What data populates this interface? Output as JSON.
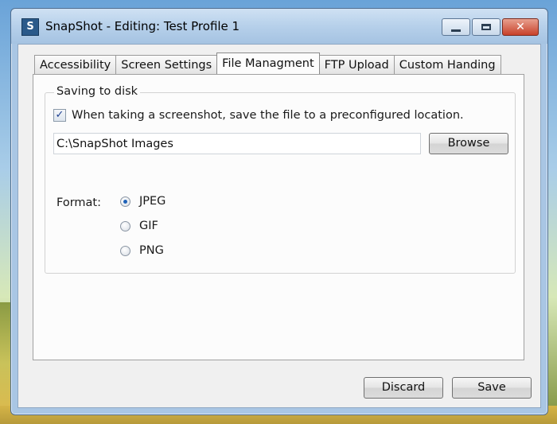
{
  "window": {
    "title": "SnapShot - Editing: Test Profile 1",
    "icon_letter": "S"
  },
  "tabs": [
    {
      "label": "Accessibility",
      "active": false
    },
    {
      "label": "Screen Settings",
      "active": false
    },
    {
      "label": "File Managment",
      "active": true
    },
    {
      "label": "FTP Upload",
      "active": false
    },
    {
      "label": "Custom Handing",
      "active": false
    }
  ],
  "saving_group": {
    "legend": "Saving to disk",
    "checkbox_label": "When taking a screenshot, save the file to a preconfigured location.",
    "checkbox_checked": true,
    "path_value": "C:\\SnapShot Images",
    "browse_label": "Browse"
  },
  "format": {
    "label": "Format:",
    "options": [
      {
        "label": "JPEG",
        "selected": true
      },
      {
        "label": "GIF",
        "selected": false
      },
      {
        "label": "PNG",
        "selected": false
      }
    ]
  },
  "footer": {
    "discard_label": "Discard",
    "save_label": "Save"
  }
}
